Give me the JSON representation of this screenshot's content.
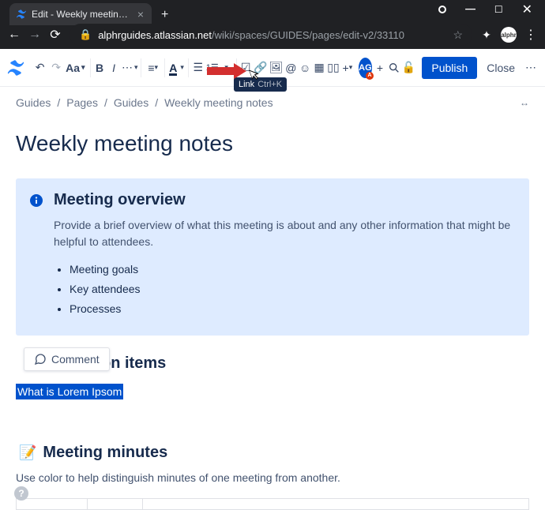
{
  "browser": {
    "tab_title": "Edit - Weekly meeting notes - Gu",
    "url_domain": "alphrguides.atlassian.net",
    "url_path": "/wiki/spaces/GUIDES/pages/edit-v2/33110",
    "avatar_text": "alphr"
  },
  "toolbar": {
    "text_style": "Aa",
    "avatar": "AG",
    "avatar_badge": "A",
    "publish": "Publish",
    "close": "Close"
  },
  "tooltip": {
    "label": "Link",
    "shortcut": "Ctrl+K"
  },
  "breadcrumb": {
    "item1": "Guides",
    "item2": "Pages",
    "item3": "Guides",
    "item4": "Weekly meeting notes"
  },
  "page": {
    "title": "Weekly meeting notes"
  },
  "panel": {
    "title": "Meeting overview",
    "description": "Provide a brief overview of what this meeting is about and any other information that might be helpful to attendees.",
    "list": {
      "item1": "Meeting goals",
      "item2": "Key attendees",
      "item3": "Processes"
    }
  },
  "comment": {
    "label": "Comment"
  },
  "sections": {
    "action_items_suffix": "on items",
    "selected_text": "What is Lorem Ipsom",
    "minutes_emoji": "📝",
    "minutes_title": "Meeting minutes",
    "minutes_desc": "Use color to help distinguish minutes of one meeting from another."
  },
  "help": "?"
}
